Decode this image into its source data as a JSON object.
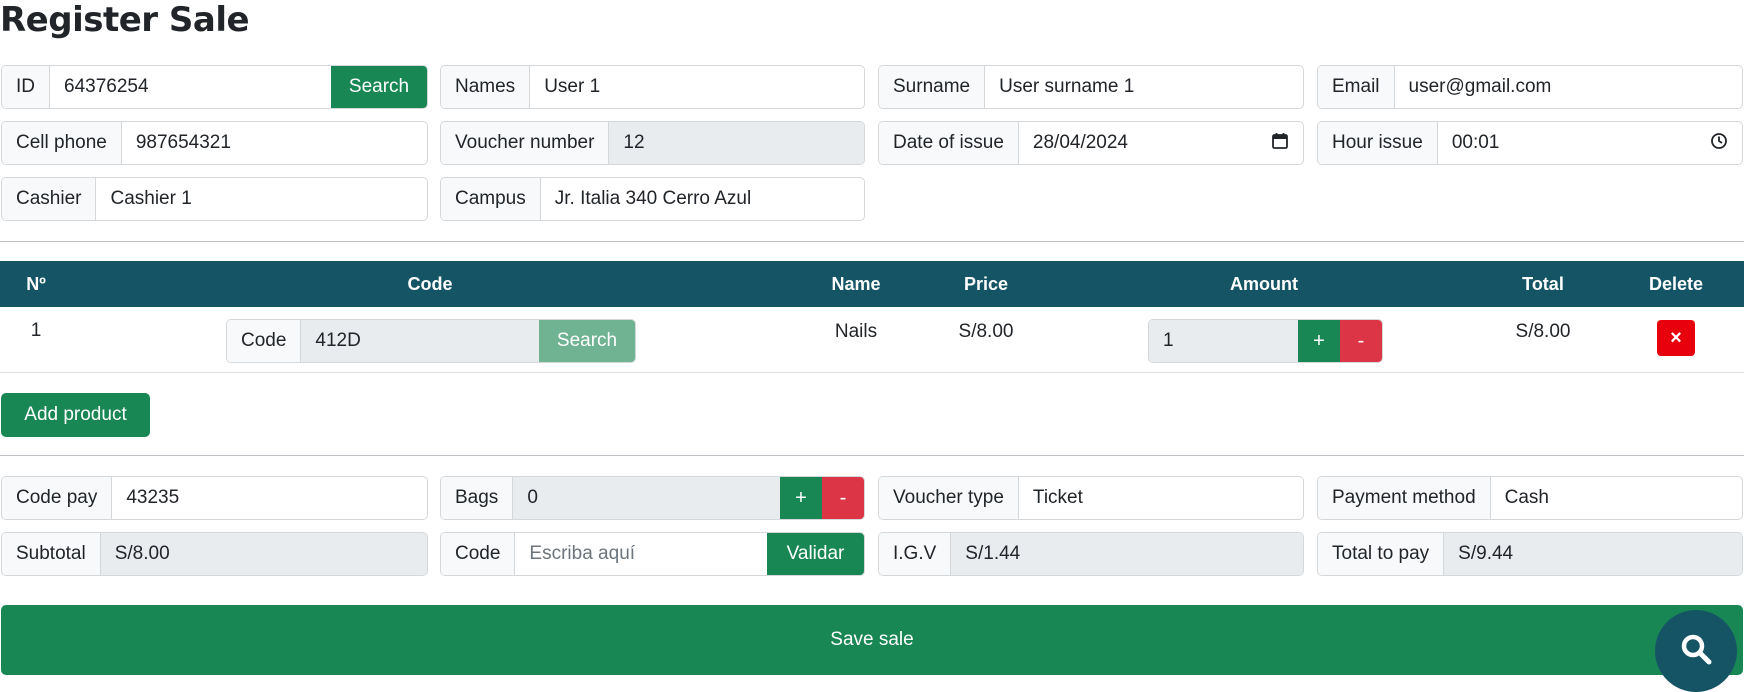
{
  "page": {
    "title": "Register Sale"
  },
  "customer": {
    "id_label": "ID",
    "id_value": "64376254",
    "id_search": "Search",
    "names_label": "Names",
    "names_value": "User 1",
    "surname_label": "Surname",
    "surname_value": "User surname 1",
    "email_label": "Email",
    "email_value": "user@gmail.com",
    "cell_label": "Cell phone",
    "cell_value": "987654321",
    "voucher_number_label": "Voucher number",
    "voucher_number_value": "12",
    "date_label": "Date of issue",
    "date_value": "28/04/2024",
    "hour_label": "Hour issue",
    "hour_value": "00:01",
    "cashier_label": "Cashier",
    "cashier_value": "Cashier 1",
    "campus_label": "Campus",
    "campus_value": "Jr. Italia 340 Cerro Azul"
  },
  "table": {
    "headers": [
      "Nº",
      "Code",
      "Name",
      "Price",
      "Amount",
      "Total",
      "Delete"
    ],
    "rows": [
      {
        "no": "1",
        "code_label": "Code",
        "code_value": "412D",
        "code_search": "Search",
        "name": "Nails",
        "price": "S/8.00",
        "amount": "1",
        "plus": "+",
        "minus": "-",
        "total": "S/8.00",
        "delete": "×"
      }
    ]
  },
  "add_product_label": "Add product",
  "payment": {
    "code_pay_label": "Code pay",
    "code_pay_value": "43235",
    "bags_label": "Bags",
    "bags_value": "0",
    "bags_plus": "+",
    "bags_minus": "-",
    "voucher_type_label": "Voucher type",
    "voucher_type_value": "Ticket",
    "payment_method_label": "Payment method",
    "payment_method_value": "Cash",
    "subtotal_label": "Subtotal",
    "subtotal_value": "S/8.00",
    "code_label": "Code",
    "code_placeholder": "Escriba aquí",
    "validate_label": "Validar",
    "igv_label": "I.G.V",
    "igv_value": "S/1.44",
    "total_label": "Total to pay",
    "total_value": "S/9.44"
  },
  "save_label": "Save sale",
  "icons": {
    "search_fab": "search-icon",
    "calendar": "calendar-icon",
    "clock": "clock-icon",
    "delete": "close-icon"
  },
  "colors": {
    "primary": "#198754",
    "header": "#145464",
    "danger": "#dc3545",
    "delete": "#e8000c"
  }
}
